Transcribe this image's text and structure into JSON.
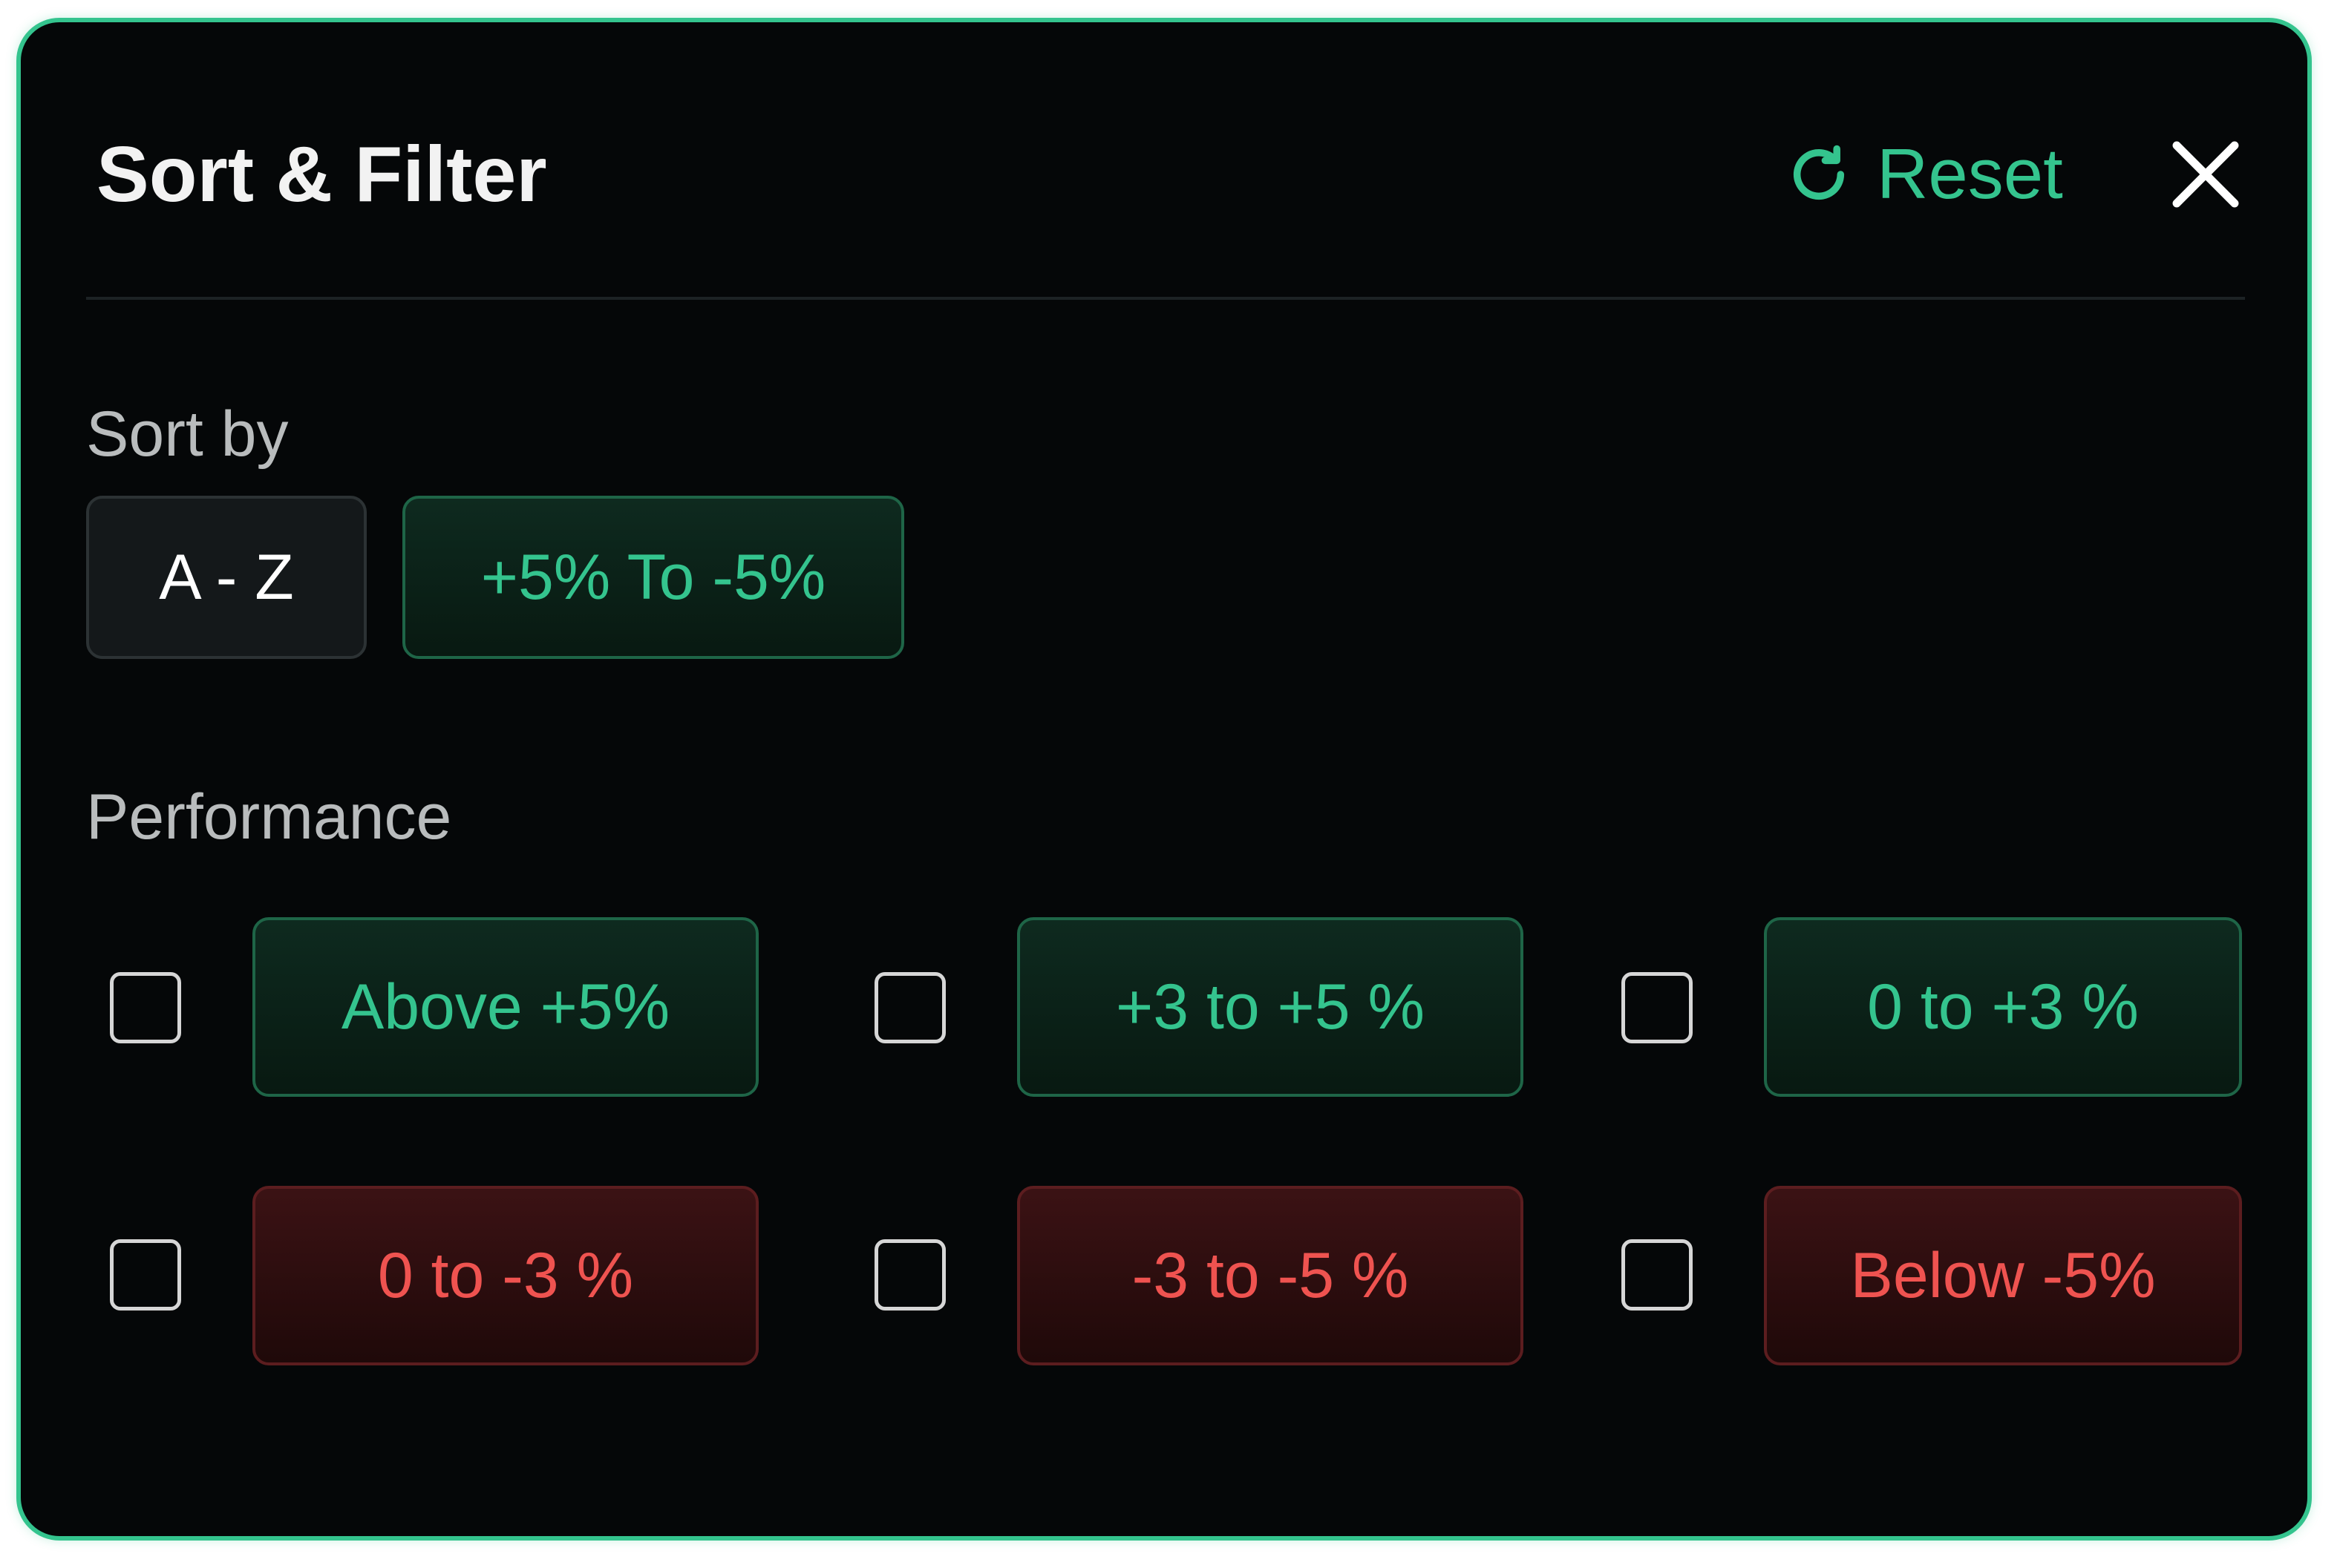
{
  "header": {
    "title": "Sort & Filter",
    "reset_label": "Reset",
    "reset_icon": "refresh-icon",
    "close_icon": "close-icon"
  },
  "sort": {
    "label": "Sort by",
    "options": [
      {
        "label": "A - Z",
        "selected": false
      },
      {
        "label": "+5% To -5%",
        "selected": true
      }
    ]
  },
  "performance": {
    "label": "Performance",
    "options": [
      {
        "label": "Above +5%",
        "tone": "positive",
        "checked": false
      },
      {
        "label": "+3 to +5 %",
        "tone": "positive",
        "checked": false
      },
      {
        "label": "0 to +3 %",
        "tone": "positive",
        "checked": false
      },
      {
        "label": "0 to -3 %",
        "tone": "negative",
        "checked": false
      },
      {
        "label": "-3 to -5 %",
        "tone": "negative",
        "checked": false
      },
      {
        "label": "Below -5%",
        "tone": "negative",
        "checked": false
      }
    ]
  },
  "colors": {
    "accent": "#34c48e",
    "negative": "#ef5350",
    "background": "#050708"
  }
}
